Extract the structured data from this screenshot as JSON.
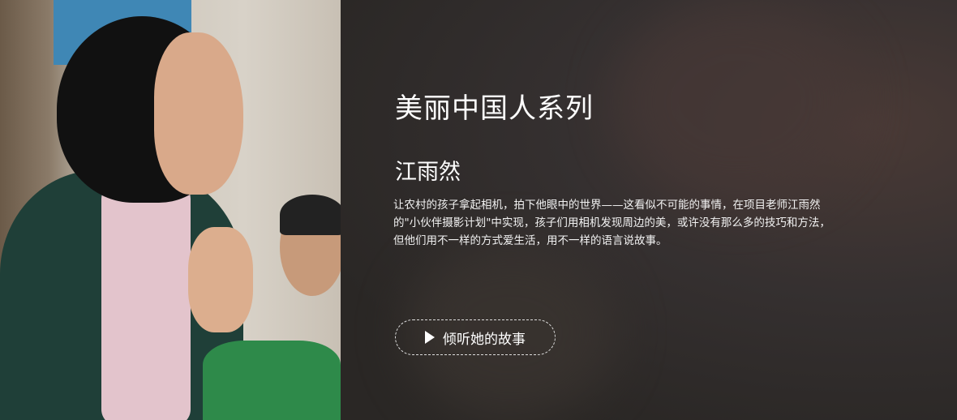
{
  "hero": {
    "series_title": "美丽中国人系列",
    "person_name": "江雨然",
    "description": "让农村的孩子拿起相机，拍下他眼中的世界——这看似不可能的事情，在项目老师江雨然的\"小伙伴摄影计划\"中实现，孩子们用相机发现周边的美，或许没有那么多的技巧和方法，但他们用不一样的方式爱生活，用不一样的语言说故事。",
    "button_label": "倾听她的故事",
    "button_icon": "play-icon"
  }
}
